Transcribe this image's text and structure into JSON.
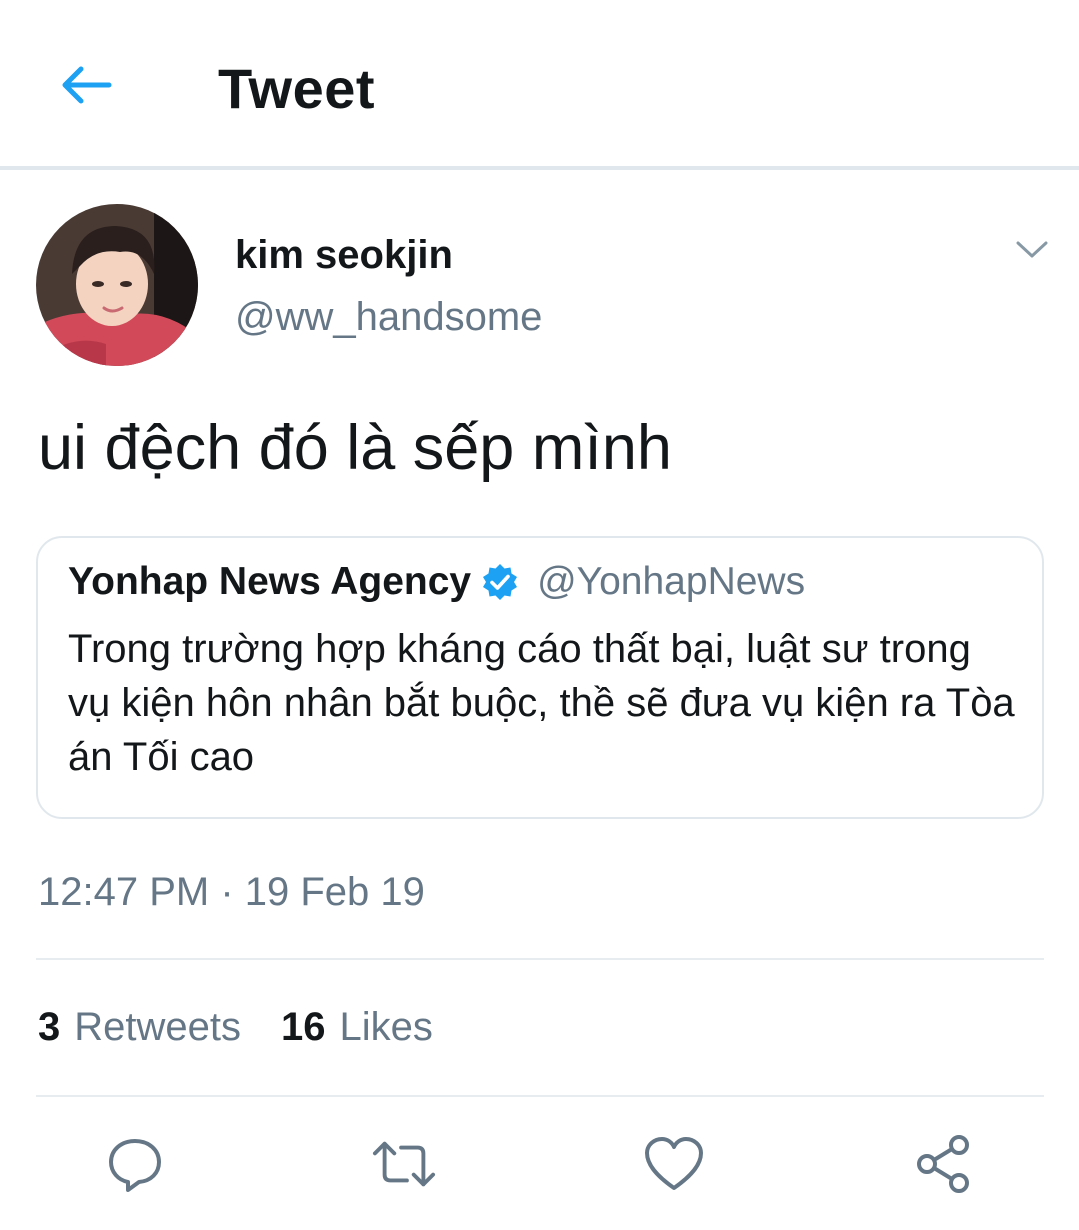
{
  "header": {
    "title": "Tweet",
    "back_icon": "arrow-left-icon"
  },
  "tweet": {
    "author": {
      "display_name": "kim seokjin",
      "handle": "@ww_handsome"
    },
    "text": "ui đệch đó là sếp mình",
    "quoted": {
      "author_name": "Yonhap News Agency",
      "verified": true,
      "author_handle": "@YonhapNews",
      "text": "Trong trường hợp kháng cáo thất bại, luật sư trong vụ kiện hôn nhân bắt buộc, thề sẽ đưa vụ kiện ra Tòa án Tối cao"
    },
    "timestamp": "12:47 PM · 19 Feb 19",
    "stats": {
      "retweets_count": "3",
      "retweets_label": "Retweets",
      "likes_count": "16",
      "likes_label": "Likes"
    }
  },
  "actions": [
    {
      "name": "reply",
      "icon": "comment-icon"
    },
    {
      "name": "retweet",
      "icon": "retweet-icon"
    },
    {
      "name": "like",
      "icon": "heart-icon"
    },
    {
      "name": "share",
      "icon": "share-icon"
    }
  ],
  "colors": {
    "accent": "#1da1f2",
    "text": "#14171a",
    "secondary": "#657786",
    "border": "#e1e8ed"
  }
}
